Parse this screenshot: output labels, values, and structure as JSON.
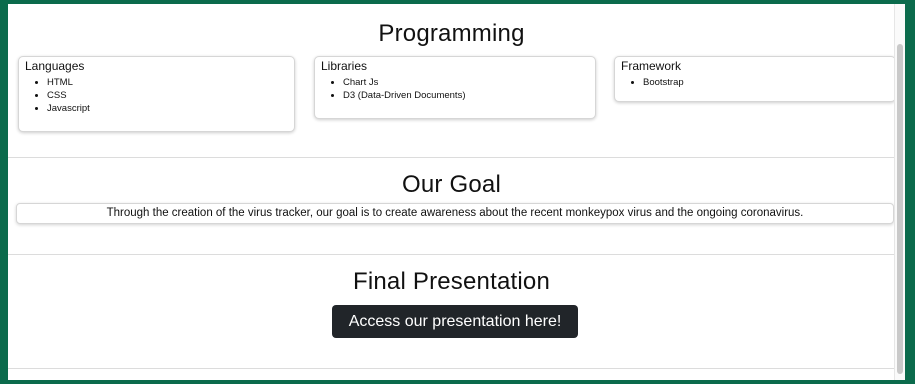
{
  "programming": {
    "title": "Programming",
    "cards": [
      {
        "title": "Languages",
        "items": [
          "HTML",
          "CSS",
          "Javascript"
        ]
      },
      {
        "title": "Libraries",
        "items": [
          "Chart Js",
          "D3 (Data-Driven Documents)"
        ]
      },
      {
        "title": "Framework",
        "items": [
          "Bootstrap"
        ]
      }
    ]
  },
  "goal": {
    "title": "Our Goal",
    "text": "Through the creation of the virus tracker, our goal is to create awareness about the recent monkeypox virus and the ongoing coronavirus."
  },
  "presentation": {
    "title": "Final Presentation",
    "button_label": "Access our presentation here!"
  },
  "colors": {
    "frame_border": "#0b6b4c",
    "button_bg": "#212529"
  }
}
